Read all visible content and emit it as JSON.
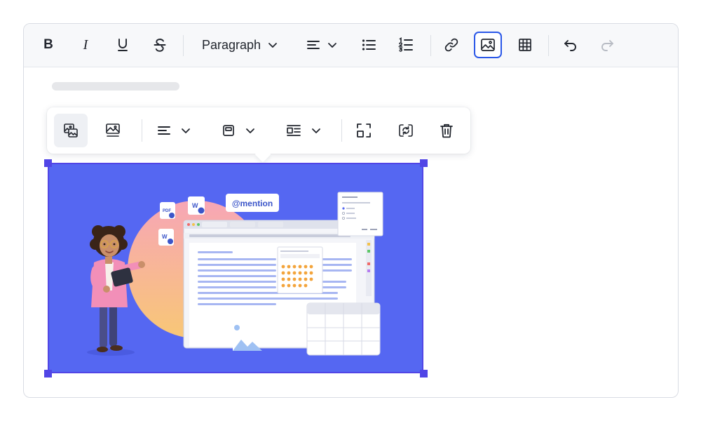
{
  "toolbar": {
    "bold_label": "B",
    "italic_label": "I",
    "block_format_label": "Paragraph"
  },
  "image": {
    "mention_label": "@mention"
  },
  "colors": {
    "accent": "#2a57e8",
    "selection": "#5145e6",
    "image_background": "#5567f2"
  }
}
